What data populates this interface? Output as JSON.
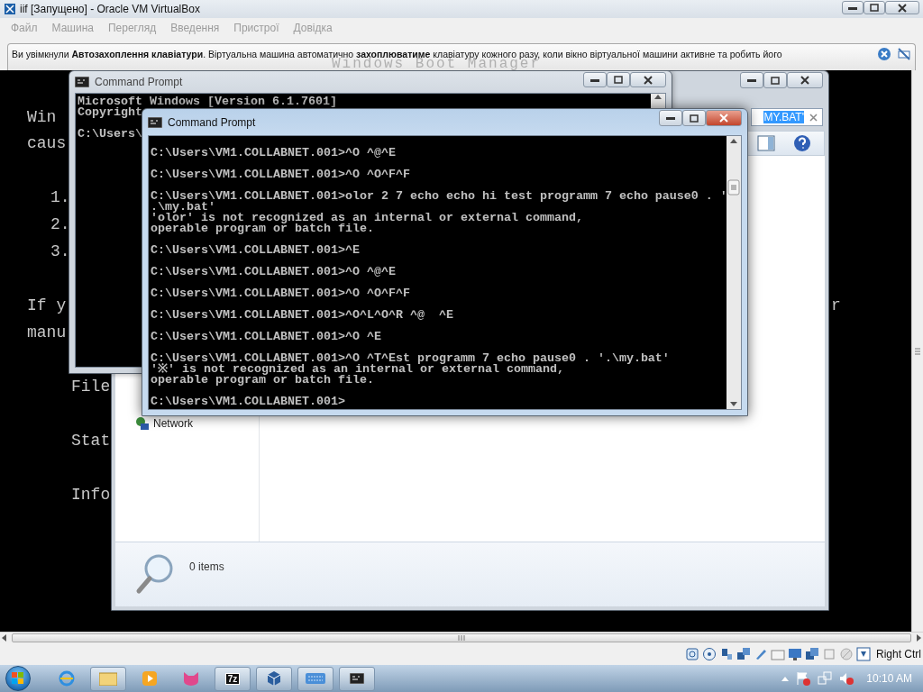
{
  "window": {
    "title": "iif [Запущено] - Oracle VM VirtualBox"
  },
  "menu": [
    {
      "label": "Файл",
      "disabled": true
    },
    {
      "label": "Машина",
      "disabled": true
    },
    {
      "label": "Перегляд",
      "disabled": true
    },
    {
      "label": "Введення",
      "disabled": true
    },
    {
      "label": "Пристрої",
      "disabled": true
    },
    {
      "label": "Довідка",
      "disabled": true
    }
  ],
  "notification": {
    "text": "Ви увімкнули **Автозахоплення клавіатури**. Віртуальна машина автоматично **захоплюватиме** клавіатуру кожного разу, коли вікно віртуальної машини активне та робить його"
  },
  "boot_screen": {
    "title": "Windows Boot Manager",
    "intro": [
      "Win",
      "caus"
    ],
    "steps": [
      "1.",
      "2.",
      "3."
    ],
    "note": [
      "If y",
      "manu"
    ],
    "note_tail": "r",
    "options": [
      "File",
      "Stat",
      "Info"
    ]
  },
  "cmd_back": {
    "title": "Command Prompt",
    "lines": [
      "Microsoft Windows [Version 6.1.7601]",
      "Copyright",
      "C:\\Users\\"
    ]
  },
  "explorer": {
    "address_selection": "MY.BAT'",
    "nav_items": [
      "Network"
    ],
    "item_count": "0 items"
  },
  "cmd_front": {
    "title": "Command Prompt",
    "blocks": [
      [
        "C:\\Users\\VM1.COLLABNET.001>^O ^@^E"
      ],
      [
        "C:\\Users\\VM1.COLLABNET.001>^O ^O^F^F"
      ],
      [
        "C:\\Users\\VM1.COLLABNET.001>olor 2 7 echo echo hi test programm 7 echo pause0 . '",
        ".\\my.bat'",
        "'olor' is not recognized as an internal or external command,",
        "operable program or batch file."
      ],
      [
        "C:\\Users\\VM1.COLLABNET.001>^E"
      ],
      [
        "C:\\Users\\VM1.COLLABNET.001>^O ^@^E"
      ],
      [
        "C:\\Users\\VM1.COLLABNET.001>^O ^O^F^F"
      ],
      [
        "C:\\Users\\VM1.COLLABNET.001>^O^L^O^R ^@  ^E"
      ],
      [
        "C:\\Users\\VM1.COLLABNET.001>^O ^E"
      ],
      [
        "C:\\Users\\VM1.COLLABNET.001>^O ^T^Est programm 7 echo pause0 . '.\\my.bat'",
        "'※' is not recognized as an internal or external command,",
        "operable program or batch file."
      ],
      [
        "C:\\Users\\VM1.COLLABNET.001>"
      ]
    ]
  },
  "vbox_status": {
    "host_key": "Right Ctrl"
  },
  "taskbar": {
    "archiver_label": "7z",
    "clock": "10:10 AM"
  }
}
